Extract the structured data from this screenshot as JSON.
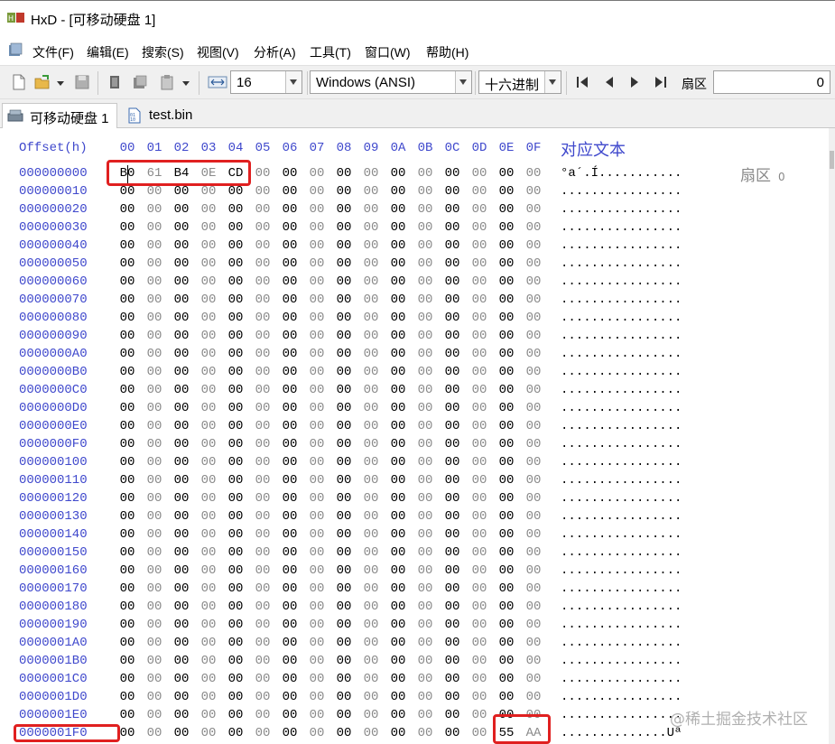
{
  "window": {
    "title": "HxD - [可移动硬盘 1]"
  },
  "menu": [
    "文件(F)",
    "编辑(E)",
    "搜索(S)",
    "视图(V)",
    "分析(A)",
    "工具(T)",
    "窗口(W)",
    "帮助(H)"
  ],
  "toolbar": {
    "bytes_per_row": "16",
    "charset": "Windows (ANSI)",
    "offset_base": "十六进制",
    "sector_label": "扇区",
    "sector_value": "0"
  },
  "tabs": [
    {
      "label": "可移动硬盘 1",
      "active": true
    },
    {
      "label": "test.bin",
      "active": false
    }
  ],
  "editor": {
    "offset_header": "Offset(h)",
    "column_headers": [
      "00",
      "01",
      "02",
      "03",
      "04",
      "05",
      "06",
      "07",
      "08",
      "09",
      "0A",
      "0B",
      "0C",
      "0D",
      "0E",
      "0F"
    ],
    "text_header": "对应文本",
    "rows": [
      {
        "offset": "000000000",
        "bytes": [
          "B0",
          "61",
          "B4",
          "0E",
          "CD",
          "00",
          "00",
          "00",
          "00",
          "00",
          "00",
          "00",
          "00",
          "00",
          "00",
          "00"
        ],
        "text": "°a´.Í..........."
      },
      {
        "offset": "000000010",
        "bytes": [
          "00",
          "00",
          "00",
          "00",
          "00",
          "00",
          "00",
          "00",
          "00",
          "00",
          "00",
          "00",
          "00",
          "00",
          "00",
          "00"
        ],
        "text": "................"
      },
      {
        "offset": "000000020",
        "bytes": [
          "00",
          "00",
          "00",
          "00",
          "00",
          "00",
          "00",
          "00",
          "00",
          "00",
          "00",
          "00",
          "00",
          "00",
          "00",
          "00"
        ],
        "text": "................"
      },
      {
        "offset": "000000030",
        "bytes": [
          "00",
          "00",
          "00",
          "00",
          "00",
          "00",
          "00",
          "00",
          "00",
          "00",
          "00",
          "00",
          "00",
          "00",
          "00",
          "00"
        ],
        "text": "................"
      },
      {
        "offset": "000000040",
        "bytes": [
          "00",
          "00",
          "00",
          "00",
          "00",
          "00",
          "00",
          "00",
          "00",
          "00",
          "00",
          "00",
          "00",
          "00",
          "00",
          "00"
        ],
        "text": "................"
      },
      {
        "offset": "000000050",
        "bytes": [
          "00",
          "00",
          "00",
          "00",
          "00",
          "00",
          "00",
          "00",
          "00",
          "00",
          "00",
          "00",
          "00",
          "00",
          "00",
          "00"
        ],
        "text": "................"
      },
      {
        "offset": "000000060",
        "bytes": [
          "00",
          "00",
          "00",
          "00",
          "00",
          "00",
          "00",
          "00",
          "00",
          "00",
          "00",
          "00",
          "00",
          "00",
          "00",
          "00"
        ],
        "text": "................"
      },
      {
        "offset": "000000070",
        "bytes": [
          "00",
          "00",
          "00",
          "00",
          "00",
          "00",
          "00",
          "00",
          "00",
          "00",
          "00",
          "00",
          "00",
          "00",
          "00",
          "00"
        ],
        "text": "................"
      },
      {
        "offset": "000000080",
        "bytes": [
          "00",
          "00",
          "00",
          "00",
          "00",
          "00",
          "00",
          "00",
          "00",
          "00",
          "00",
          "00",
          "00",
          "00",
          "00",
          "00"
        ],
        "text": "................"
      },
      {
        "offset": "000000090",
        "bytes": [
          "00",
          "00",
          "00",
          "00",
          "00",
          "00",
          "00",
          "00",
          "00",
          "00",
          "00",
          "00",
          "00",
          "00",
          "00",
          "00"
        ],
        "text": "................"
      },
      {
        "offset": "0000000A0",
        "bytes": [
          "00",
          "00",
          "00",
          "00",
          "00",
          "00",
          "00",
          "00",
          "00",
          "00",
          "00",
          "00",
          "00",
          "00",
          "00",
          "00"
        ],
        "text": "................"
      },
      {
        "offset": "0000000B0",
        "bytes": [
          "00",
          "00",
          "00",
          "00",
          "00",
          "00",
          "00",
          "00",
          "00",
          "00",
          "00",
          "00",
          "00",
          "00",
          "00",
          "00"
        ],
        "text": "................"
      },
      {
        "offset": "0000000C0",
        "bytes": [
          "00",
          "00",
          "00",
          "00",
          "00",
          "00",
          "00",
          "00",
          "00",
          "00",
          "00",
          "00",
          "00",
          "00",
          "00",
          "00"
        ],
        "text": "................"
      },
      {
        "offset": "0000000D0",
        "bytes": [
          "00",
          "00",
          "00",
          "00",
          "00",
          "00",
          "00",
          "00",
          "00",
          "00",
          "00",
          "00",
          "00",
          "00",
          "00",
          "00"
        ],
        "text": "................"
      },
      {
        "offset": "0000000E0",
        "bytes": [
          "00",
          "00",
          "00",
          "00",
          "00",
          "00",
          "00",
          "00",
          "00",
          "00",
          "00",
          "00",
          "00",
          "00",
          "00",
          "00"
        ],
        "text": "................"
      },
      {
        "offset": "0000000F0",
        "bytes": [
          "00",
          "00",
          "00",
          "00",
          "00",
          "00",
          "00",
          "00",
          "00",
          "00",
          "00",
          "00",
          "00",
          "00",
          "00",
          "00"
        ],
        "text": "................"
      },
      {
        "offset": "000000100",
        "bytes": [
          "00",
          "00",
          "00",
          "00",
          "00",
          "00",
          "00",
          "00",
          "00",
          "00",
          "00",
          "00",
          "00",
          "00",
          "00",
          "00"
        ],
        "text": "................"
      },
      {
        "offset": "000000110",
        "bytes": [
          "00",
          "00",
          "00",
          "00",
          "00",
          "00",
          "00",
          "00",
          "00",
          "00",
          "00",
          "00",
          "00",
          "00",
          "00",
          "00"
        ],
        "text": "................"
      },
      {
        "offset": "000000120",
        "bytes": [
          "00",
          "00",
          "00",
          "00",
          "00",
          "00",
          "00",
          "00",
          "00",
          "00",
          "00",
          "00",
          "00",
          "00",
          "00",
          "00"
        ],
        "text": "................"
      },
      {
        "offset": "000000130",
        "bytes": [
          "00",
          "00",
          "00",
          "00",
          "00",
          "00",
          "00",
          "00",
          "00",
          "00",
          "00",
          "00",
          "00",
          "00",
          "00",
          "00"
        ],
        "text": "................"
      },
      {
        "offset": "000000140",
        "bytes": [
          "00",
          "00",
          "00",
          "00",
          "00",
          "00",
          "00",
          "00",
          "00",
          "00",
          "00",
          "00",
          "00",
          "00",
          "00",
          "00"
        ],
        "text": "................"
      },
      {
        "offset": "000000150",
        "bytes": [
          "00",
          "00",
          "00",
          "00",
          "00",
          "00",
          "00",
          "00",
          "00",
          "00",
          "00",
          "00",
          "00",
          "00",
          "00",
          "00"
        ],
        "text": "................"
      },
      {
        "offset": "000000160",
        "bytes": [
          "00",
          "00",
          "00",
          "00",
          "00",
          "00",
          "00",
          "00",
          "00",
          "00",
          "00",
          "00",
          "00",
          "00",
          "00",
          "00"
        ],
        "text": "................"
      },
      {
        "offset": "000000170",
        "bytes": [
          "00",
          "00",
          "00",
          "00",
          "00",
          "00",
          "00",
          "00",
          "00",
          "00",
          "00",
          "00",
          "00",
          "00",
          "00",
          "00"
        ],
        "text": "................"
      },
      {
        "offset": "000000180",
        "bytes": [
          "00",
          "00",
          "00",
          "00",
          "00",
          "00",
          "00",
          "00",
          "00",
          "00",
          "00",
          "00",
          "00",
          "00",
          "00",
          "00"
        ],
        "text": "................"
      },
      {
        "offset": "000000190",
        "bytes": [
          "00",
          "00",
          "00",
          "00",
          "00",
          "00",
          "00",
          "00",
          "00",
          "00",
          "00",
          "00",
          "00",
          "00",
          "00",
          "00"
        ],
        "text": "................"
      },
      {
        "offset": "0000001A0",
        "bytes": [
          "00",
          "00",
          "00",
          "00",
          "00",
          "00",
          "00",
          "00",
          "00",
          "00",
          "00",
          "00",
          "00",
          "00",
          "00",
          "00"
        ],
        "text": "................"
      },
      {
        "offset": "0000001B0",
        "bytes": [
          "00",
          "00",
          "00",
          "00",
          "00",
          "00",
          "00",
          "00",
          "00",
          "00",
          "00",
          "00",
          "00",
          "00",
          "00",
          "00"
        ],
        "text": "................"
      },
      {
        "offset": "0000001C0",
        "bytes": [
          "00",
          "00",
          "00",
          "00",
          "00",
          "00",
          "00",
          "00",
          "00",
          "00",
          "00",
          "00",
          "00",
          "00",
          "00",
          "00"
        ],
        "text": "................"
      },
      {
        "offset": "0000001D0",
        "bytes": [
          "00",
          "00",
          "00",
          "00",
          "00",
          "00",
          "00",
          "00",
          "00",
          "00",
          "00",
          "00",
          "00",
          "00",
          "00",
          "00"
        ],
        "text": "................"
      },
      {
        "offset": "0000001E0",
        "bytes": [
          "00",
          "00",
          "00",
          "00",
          "00",
          "00",
          "00",
          "00",
          "00",
          "00",
          "00",
          "00",
          "00",
          "00",
          "00",
          "00"
        ],
        "text": "................"
      },
      {
        "offset": "0000001F0",
        "bytes": [
          "00",
          "00",
          "00",
          "00",
          "00",
          "00",
          "00",
          "00",
          "00",
          "00",
          "00",
          "00",
          "00",
          "00",
          "55",
          "AA"
        ],
        "text": "..............Uª"
      }
    ],
    "sector_label": "扇区",
    "sector_number": "0"
  },
  "watermark": "@稀土掘金技术社区"
}
